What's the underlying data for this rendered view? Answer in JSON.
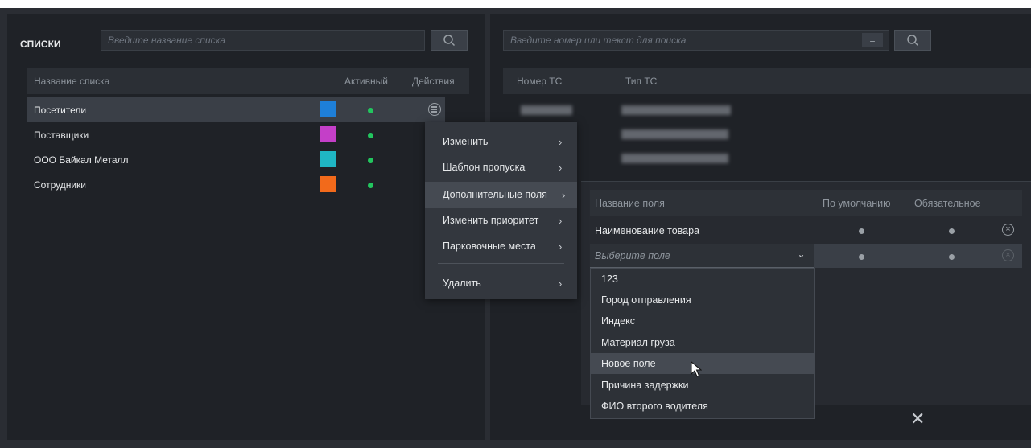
{
  "left": {
    "title": "СПИСКИ",
    "search_placeholder": "Введите название списка",
    "columns": [
      "Название списка",
      "Активный",
      "Действия"
    ],
    "rows": [
      {
        "name": "Посетители",
        "color": "#1e7fd8"
      },
      {
        "name": "Поставщики",
        "color": "#c43fc8"
      },
      {
        "name": "ООО Байкал Металл",
        "color": "#1fb6c4"
      },
      {
        "name": "Сотрудники",
        "color": "#f26a1b"
      }
    ]
  },
  "context_menu": {
    "items": [
      "Изменить",
      "Шаблон пропуска",
      "Дополнительные поля",
      "Изменить приоритет",
      "Парковочные места",
      "Удалить"
    ]
  },
  "right": {
    "search_placeholder": "Введите номер или текст для поиска",
    "filter_symbol": "=",
    "columns": [
      "Номер ТС",
      "Тип ТС"
    ]
  },
  "fields": {
    "columns": [
      "Название поля",
      "По умолчанию",
      "Обязательное"
    ],
    "row_name": "Наименование товара",
    "select_placeholder": "Выберите поле",
    "options": [
      "123",
      "Город отправления",
      "Индекс",
      "Материал груза",
      "Новое поле",
      "Причина задержки",
      "ФИО второго водителя"
    ],
    "close_symbol": "✕"
  },
  "colors": {
    "active_dot": "#22c55e",
    "background": "#1f2227"
  }
}
